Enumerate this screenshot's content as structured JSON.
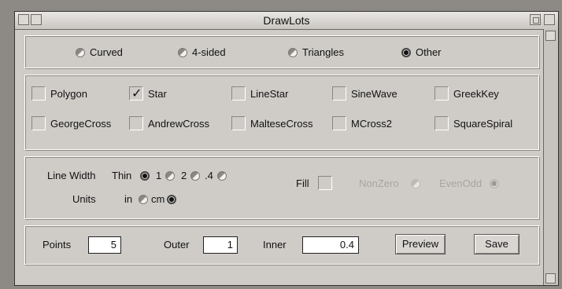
{
  "window": {
    "title": "DrawLots"
  },
  "shape_types": [
    {
      "label": "Curved",
      "selected": false
    },
    {
      "label": "4-sided",
      "selected": false
    },
    {
      "label": "Triangles",
      "selected": false
    },
    {
      "label": "Other",
      "selected": true
    }
  ],
  "shapes": [
    {
      "label": "Polygon",
      "checked": false
    },
    {
      "label": "Star",
      "checked": true
    },
    {
      "label": "LineStar",
      "checked": false
    },
    {
      "label": "SineWave",
      "checked": false
    },
    {
      "label": "GreekKey",
      "checked": false
    },
    {
      "label": "GeorgeCross",
      "checked": false
    },
    {
      "label": "AndrewCross",
      "checked": false
    },
    {
      "label": "MalteseCross",
      "checked": false
    },
    {
      "label": "MCross2",
      "checked": false
    },
    {
      "label": "SquareSpiral",
      "checked": false
    }
  ],
  "line_width": {
    "label": "Line Width",
    "thin_label": "Thin",
    "options": [
      {
        "label": "1",
        "selected": false
      },
      {
        "label": "2",
        "selected": false
      },
      {
        "label": ".4",
        "selected": false
      }
    ],
    "thin_selected": true
  },
  "units": {
    "label": "Units",
    "options": [
      {
        "label": "in",
        "selected": false
      },
      {
        "label": "cm",
        "selected": true
      }
    ]
  },
  "fill": {
    "label": "Fill",
    "checked": false,
    "rules": [
      {
        "label": "NonZero",
        "selected": false,
        "enabled": false
      },
      {
        "label": "EvenOdd",
        "selected": true,
        "enabled": false
      }
    ]
  },
  "params": {
    "points_label": "Points",
    "points_value": "5",
    "outer_label": "Outer",
    "outer_value": "1",
    "inner_label": "Inner",
    "inner_value": "0.4"
  },
  "buttons": {
    "preview": "Preview",
    "save": "Save"
  }
}
